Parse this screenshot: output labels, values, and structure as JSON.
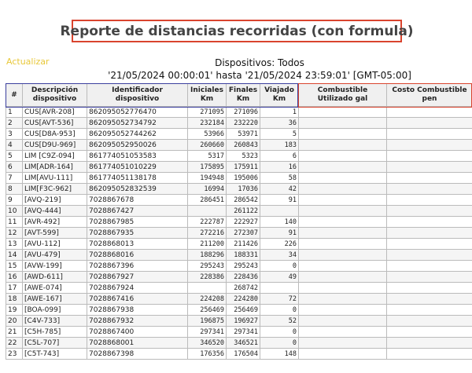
{
  "report": {
    "title": "Reporte de distancias recorridas (con formula)",
    "refresh_label": "Actualizar",
    "devices_line": "Dispositivos: Todos",
    "range_line": "'21/05/2024 00:00:01' hasta '21/05/2024 23:59:01' [GMT-05:00]"
  },
  "table": {
    "headers": [
      "#",
      "Descripción dispositivo",
      "Identificador dispositivo",
      "Iniciales Km",
      "Finales Km",
      "Viajado Km",
      "Combustible Utilizado gal",
      "Costo Combustible pen"
    ],
    "rows": [
      [
        "1",
        "CUS[AVR-208]",
        "862095052776470",
        "271095",
        "271096",
        "1",
        "",
        ""
      ],
      [
        "2",
        "CUS[AVT-536]",
        "862095052734792",
        "232184",
        "232220",
        "36",
        "",
        ""
      ],
      [
        "3",
        "CUS[D8A-953]",
        "862095052744262",
        "53966",
        "53971",
        "5",
        "",
        ""
      ],
      [
        "4",
        "CUS[D9U-969]",
        "862095052950026",
        "260660",
        "260843",
        "183",
        "",
        ""
      ],
      [
        "5",
        "LIM [C9Z-094]",
        "861774051053583",
        "5317",
        "5323",
        "6",
        "",
        ""
      ],
      [
        "6",
        "LIM[ADR-164]",
        "861774051010229",
        "175895",
        "175911",
        "16",
        "",
        ""
      ],
      [
        "7",
        "LIM[AVU-111]",
        "861774051138178",
        "194948",
        "195006",
        "58",
        "",
        ""
      ],
      [
        "8",
        "LIM[F3C-962]",
        "862095052832539",
        "16994",
        "17036",
        "42",
        "",
        ""
      ],
      [
        "9",
        "[AVQ-219]",
        "7028867678",
        "286451",
        "286542",
        "91",
        "",
        ""
      ],
      [
        "10",
        "[AVQ-444]",
        "7028867427",
        "",
        "261122",
        "",
        "",
        ""
      ],
      [
        "11",
        "[AVR-492]",
        "7028867985",
        "222787",
        "222927",
        "140",
        "",
        ""
      ],
      [
        "12",
        "[AVT-599]",
        "7028867935",
        "272216",
        "272307",
        "91",
        "",
        ""
      ],
      [
        "13",
        "[AVU-112]",
        "7028868013",
        "211200",
        "211426",
        "226",
        "",
        ""
      ],
      [
        "14",
        "[AVU-479]",
        "7028868016",
        "188296",
        "188331",
        "34",
        "",
        ""
      ],
      [
        "15",
        "[AVW-199]",
        "7028867396",
        "295243",
        "295243",
        "0",
        "",
        ""
      ],
      [
        "16",
        "[AWD-611]",
        "7028867927",
        "228386",
        "228436",
        "49",
        "",
        ""
      ],
      [
        "17",
        "[AWE-074]",
        "7028867924",
        "",
        "268742",
        "",
        "",
        ""
      ],
      [
        "18",
        "[AWE-167]",
        "7028867416",
        "224208",
        "224280",
        "72",
        "",
        ""
      ],
      [
        "19",
        "[BOA-099]",
        "7028867938",
        "256469",
        "256469",
        "0",
        "",
        ""
      ],
      [
        "20",
        "[C4V-733]",
        "7028867932",
        "196875",
        "196927",
        "52",
        "",
        ""
      ],
      [
        "21",
        "[C5H-785]",
        "7028867400",
        "297341",
        "297341",
        "0",
        "",
        ""
      ],
      [
        "22",
        "[C5L-707]",
        "7028868001",
        "346520",
        "346521",
        "0",
        "",
        ""
      ],
      [
        "23",
        "[C5T-743]",
        "7028867398",
        "176356",
        "176504",
        "148",
        "",
        ""
      ]
    ]
  },
  "colors": {
    "title_border": "#d9442e",
    "refresh_link": "#e8c83a",
    "header_frame_left": "#3b3f9e",
    "header_frame_right": "#d9442e"
  }
}
